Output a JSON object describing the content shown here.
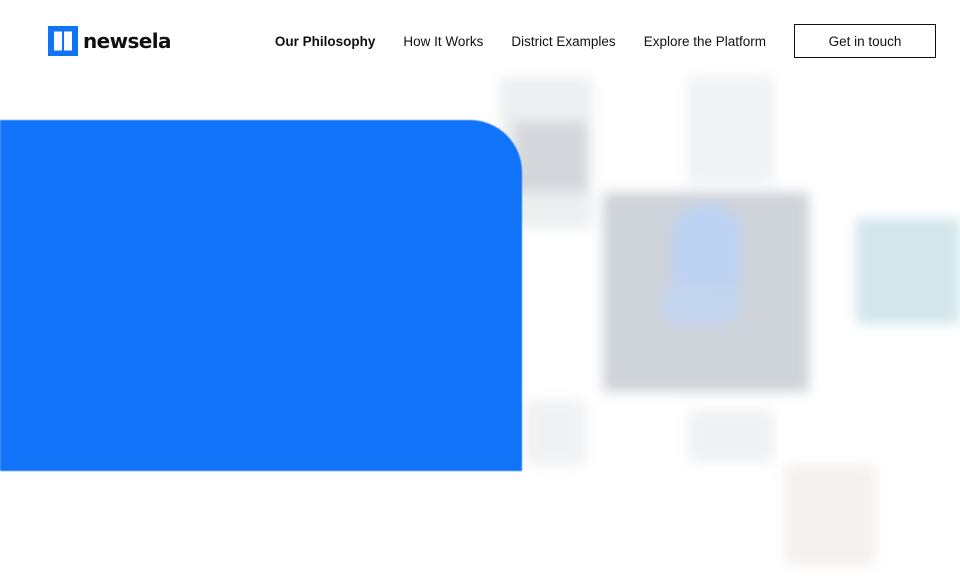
{
  "brand": {
    "name": "newsela",
    "logo_icon": "newsela-book-icon",
    "accent_color": "#1073f8"
  },
  "nav": {
    "items": [
      {
        "label": "Our Philosophy",
        "active": true
      },
      {
        "label": "How It Works",
        "active": false
      },
      {
        "label": "District Examples",
        "active": false
      },
      {
        "label": "Explore the Platform",
        "active": false
      }
    ],
    "cta_label": "Get in touch"
  },
  "hero": {
    "panel_color": "#1073f8",
    "card_colors": {
      "gray": "#cfd3da",
      "light": "#eef0f3",
      "teal": "#d2e6ec",
      "tint": "#bcd2f3"
    }
  }
}
